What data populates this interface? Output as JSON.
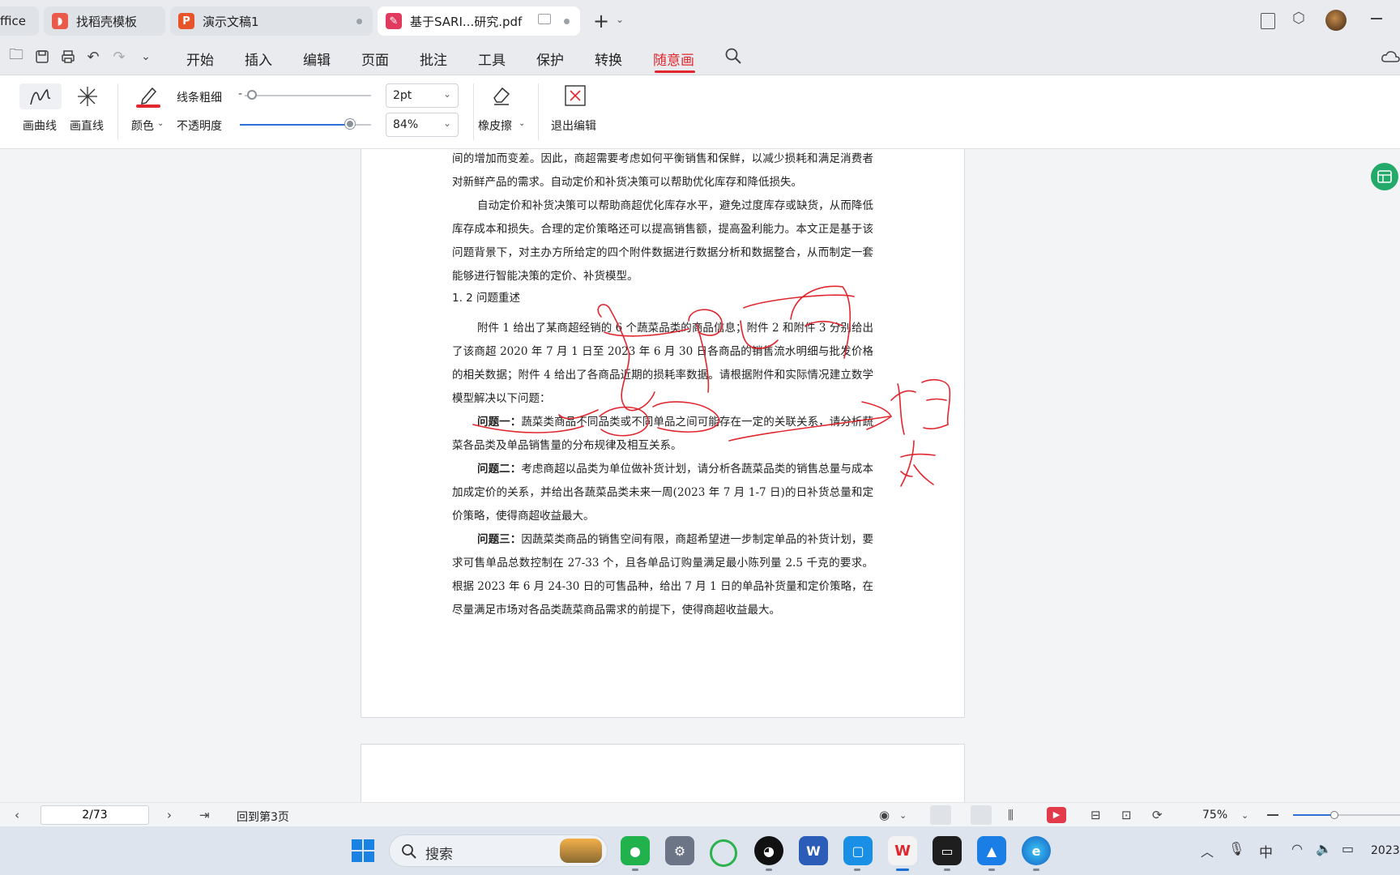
{
  "tabs": [
    {
      "label": "ffice"
    },
    {
      "label": "找稻壳模板"
    },
    {
      "label": "演示文稿1"
    },
    {
      "label": "基于SARI...研究.pdf"
    }
  ],
  "menu": [
    "开始",
    "插入",
    "编辑",
    "页面",
    "批注",
    "工具",
    "保护",
    "转换",
    "随意画"
  ],
  "ribbon": {
    "curve_label": "画曲线",
    "line_label": "画直线",
    "color_label": "颜色",
    "thickness_label": "线条粗细",
    "thickness_value": "2pt",
    "thickness_level": 0.06,
    "opacity_label": "不透明度",
    "opacity_value": "84%",
    "opacity_level": 0.84,
    "eraser_label": "橡皮擦",
    "exit_label": "退出编辑",
    "pen_color": "#e0272e"
  },
  "doc": {
    "p1": "间的增加而变差。因此，商超需要考虑如何平衡销售和保鲜，以减少损耗和满足消费者对新鲜产品的需求。自动定价和补货决策可以帮助优化库存和降低损失。",
    "p2": "自动定价和补货决策可以帮助商超优化库存水平，避免过度库存或缺货，从而降低库存成本和损失。合理的定价策略还可以提高销售额，提高盈利能力。本文正是基于该问题背景下，对主办方所给定的四个附件数据进行数据分析和数据整合，从而制定一套能够进行智能决策的定价、补货模型。",
    "heading": "1. 2  问题重述",
    "p3": "附件 1 给出了某商超经销的 6 个蔬菜品类的商品信息；附件 2 和附件 3 分别给出了该商超 2020 年 7 月 1 日至 2023 年 6 月 30 日各商品的销售流水明细与批发价格的相关数据；附件 4 给出了各商品近期的损耗率数据。请根据附件和实际情况建立数学模型解决以下问题：",
    "q1_label": "问题一：",
    "q1_text": "蔬菜类商品不同品类或不同单品之间可能存在一定的关联关系，请分析蔬菜各品类及单品销售量的分布规律及相互关系。",
    "q2_label": "问题二：",
    "q2_text": "考虑商超以品类为单位做补货计划，请分析各蔬菜品类的销售总量与成本加成定价的关系，并给出各蔬菜品类未来一周(2023 年 7 月 1-7 日)的日补货总量和定价策略，使得商超收益最大。",
    "q3_label": "问题三：",
    "q3_text": "因蔬菜类商品的销售空间有限，商超希望进一步制定单品的补货计划，要求可售单品总数控制在 27-33 个，且各单品订购量满足最小陈列量 2.5 千克的要求。根据 2023 年 6 月 24-30 日的可售品种，给出 7 月 1 日的单品补货量和定价策略，在尽量满足市场对各品类蔬菜商品需求的前提下，使得商超收益最大。"
  },
  "status": {
    "page_input": "2/73",
    "goto": "回到第3页",
    "zoom": "75%"
  },
  "taskbar": {
    "search": "搜索",
    "clock": "2023",
    "ime": "中"
  }
}
